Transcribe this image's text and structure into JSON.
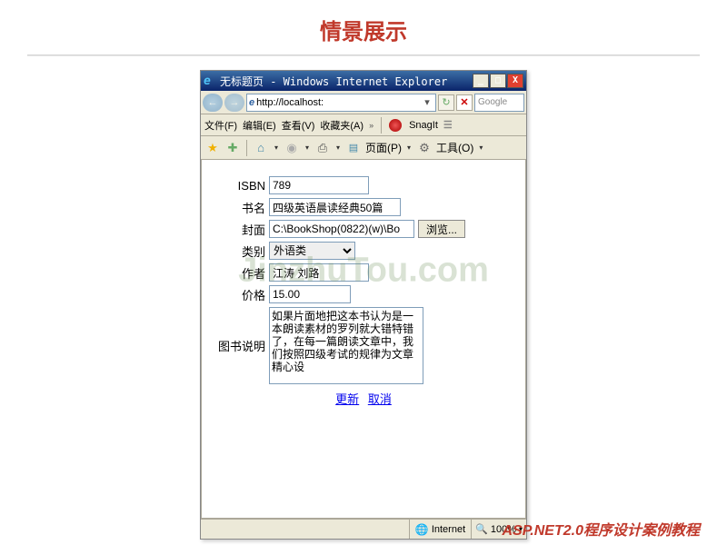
{
  "page_title": "情景展示",
  "watermark": "JinzhuTou.com",
  "footer": "ASP.NET2.0程序设计案例教程",
  "browser": {
    "title": "无标题页 - Windows Internet Explorer",
    "address": "http://localhost:",
    "search_placeholder": "Google",
    "menu": {
      "file": "文件(F)",
      "edit": "编辑(E)",
      "view": "查看(V)",
      "favorites": "收藏夹(A)",
      "snagit": "SnagIt"
    },
    "toolbar": {
      "page": "页面(P)",
      "tools": "工具(O)"
    },
    "status": {
      "zone": "Internet",
      "zoom": "100%"
    }
  },
  "form": {
    "isbn_label": "ISBN",
    "isbn_value": "789",
    "title_label": "书名",
    "title_value": "四级英语晨读经典50篇",
    "cover_label": "封面",
    "cover_value": "C:\\BookShop(0822)(w)\\Bo",
    "browse_btn": "浏览...",
    "category_label": "类别",
    "category_value": "外语类",
    "author_label": "作者",
    "author_value": "江涛 刘路",
    "price_label": "价格",
    "price_value": "15.00",
    "desc_label": "图书说明",
    "desc_value": "如果片面地把这本书认为是一本朗读素材的罗列就大错特错了，在每一篇朗读文章中，我们按照四级考试的规律为文章精心设",
    "update_link": "更新",
    "cancel_link": "取消"
  }
}
